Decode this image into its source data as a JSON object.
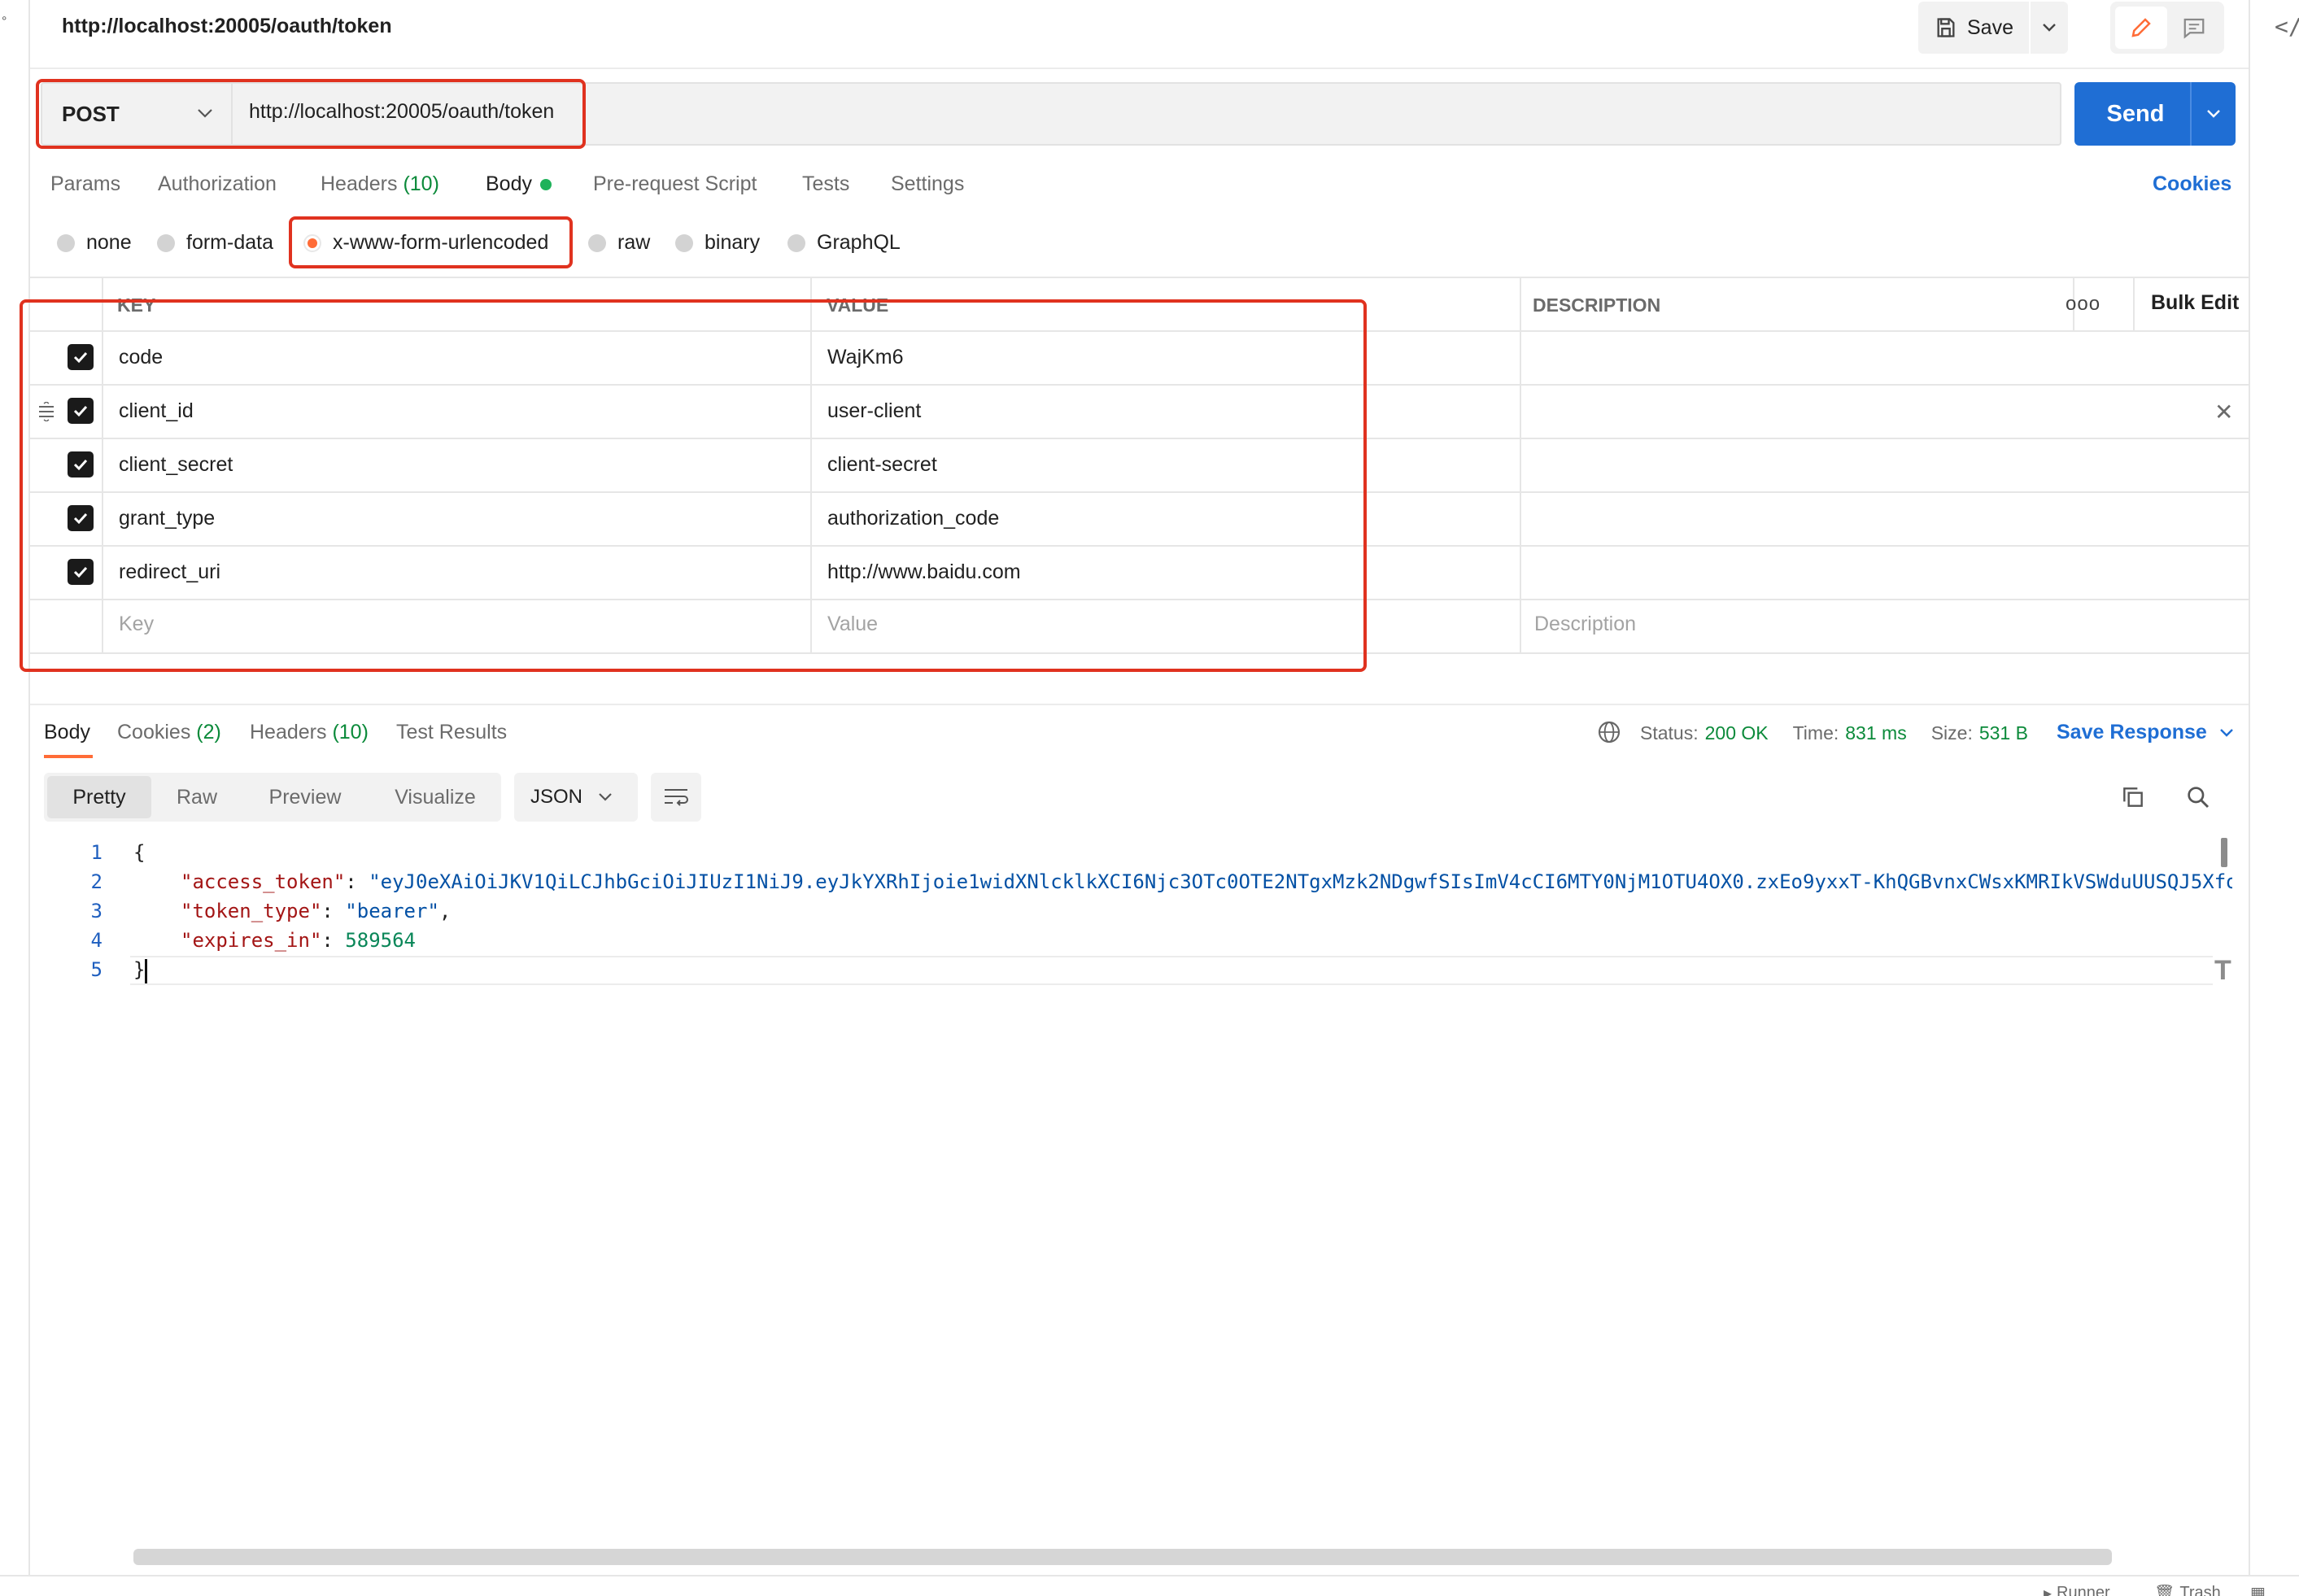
{
  "header": {
    "title": "http://localhost:20005/oauth/token",
    "save_label": "Save"
  },
  "request": {
    "method": "POST",
    "url": "http://localhost:20005/oauth/token",
    "send_label": "Send"
  },
  "request_tabs": [
    {
      "label": "Params"
    },
    {
      "label": "Authorization"
    },
    {
      "label": "Headers",
      "count": "(10)"
    },
    {
      "label": "Body"
    },
    {
      "label": "Pre-request Script"
    },
    {
      "label": "Tests"
    },
    {
      "label": "Settings"
    }
  ],
  "cookies_link": "Cookies",
  "body_types": [
    {
      "label": "none",
      "selected": false
    },
    {
      "label": "form-data",
      "selected": false
    },
    {
      "label": "x-www-form-urlencoded",
      "selected": true
    },
    {
      "label": "raw",
      "selected": false
    },
    {
      "label": "binary",
      "selected": false
    },
    {
      "label": "GraphQL",
      "selected": false
    }
  ],
  "params_table": {
    "headers": {
      "key": "KEY",
      "value": "VALUE",
      "description": "DESCRIPTION",
      "bulk_edit": "Bulk Edit"
    },
    "rows": [
      {
        "key": "code",
        "value": "WajKm6",
        "checked": true
      },
      {
        "key": "client_id",
        "value": "user-client",
        "checked": true
      },
      {
        "key": "client_secret",
        "value": "client-secret",
        "checked": true
      },
      {
        "key": "grant_type",
        "value": "authorization_code",
        "checked": true
      },
      {
        "key": "redirect_uri",
        "value": "http://www.baidu.com",
        "checked": true
      }
    ],
    "placeholders": {
      "key": "Key",
      "value": "Value",
      "description": "Description"
    }
  },
  "response": {
    "tabs": [
      {
        "label": "Body"
      },
      {
        "label": "Cookies",
        "count": "(2)"
      },
      {
        "label": "Headers",
        "count": "(10)"
      },
      {
        "label": "Test Results"
      }
    ],
    "status_label": "Status:",
    "status_value": "200 OK",
    "time_label": "Time:",
    "time_value": "831 ms",
    "size_label": "Size:",
    "size_value": "531 B",
    "save_response_label": "Save Response",
    "views": [
      "Pretty",
      "Raw",
      "Preview",
      "Visualize"
    ],
    "format": "JSON",
    "code": {
      "line_numbers": [
        "1",
        "2",
        "3",
        "4",
        "5"
      ],
      "open_brace": "{",
      "close_brace": "}",
      "access_token_key": "\"access_token\"",
      "access_token_value": "\"eyJ0eXAiOiJKV1QiLCJhbGciOiJIUzI1NiJ9.eyJkYXRhIjoie1widXNlcklkXCI6Njc3OTc0OTE2NTgxMzk2NDgwfSIsImV4cCI6MTY0NjM1OTU4OX0.zxEo9yxxT-KhQGBvnxCWsxKMRIkVSWduUUSQJ5Xfo",
      "token_type_key": "\"token_type\"",
      "token_type_value": "\"bearer\"",
      "expires_in_key": "\"expires_in\"",
      "expires_in_value": "589564"
    }
  },
  "footer": {
    "runner": "Runner",
    "trash": "Trash"
  },
  "colors": {
    "accent": "#ff6c37",
    "primary_blue": "#1f6ed4",
    "success_green": "#0b8a3a",
    "highlight_red": "#e0321f"
  }
}
